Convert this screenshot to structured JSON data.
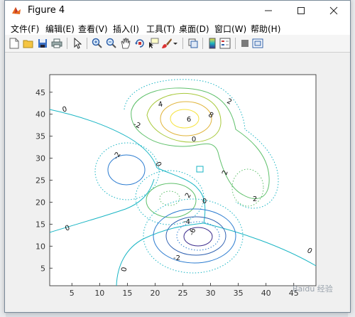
{
  "window": {
    "title": "Figure 4"
  },
  "menu": [
    {
      "label": "文件(F)"
    },
    {
      "label": "编辑(E)"
    },
    {
      "label": "查看(V)"
    },
    {
      "label": "插入(I)"
    },
    {
      "label": "工具(T)"
    },
    {
      "label": "桌面(D)"
    },
    {
      "label": "窗口(W)"
    },
    {
      "label": "帮助(H)"
    }
  ],
  "toolbar": [
    "new-figure-icon",
    "open-file-icon",
    "save-icon",
    "print-icon",
    "pointer-icon",
    "zoom-in-icon",
    "zoom-out-icon",
    "pan-hand-icon",
    "rotate-3d-icon",
    "data-cursor-icon",
    "brush-icon",
    "brush-dropdown-icon",
    "link-plot-icon",
    "colorbar-icon",
    "legend-icon",
    "hide-plot-tools-icon",
    "show-plot-tools-icon"
  ],
  "chart_data": {
    "type": "contour",
    "title": "",
    "xlabel": "",
    "ylabel": "",
    "xlim": [
      1,
      49
    ],
    "ylim": [
      1,
      49
    ],
    "x_ticks": [
      5,
      10,
      15,
      20,
      25,
      30,
      35,
      40,
      45
    ],
    "y_ticks": [
      5,
      10,
      15,
      20,
      25,
      30,
      35,
      40,
      45
    ],
    "contour_labels": [
      "0",
      "2",
      "4",
      "6",
      "8",
      "-2",
      "0",
      "0",
      "-2",
      "2",
      "2",
      "2",
      "0",
      "-4",
      "-6",
      "-2",
      "0",
      "0",
      "0"
    ],
    "colors": {
      "negative_deep": "#3a2a8c",
      "negative": "#2a7bd0",
      "zero": "#19b5c4",
      "positive": "#5fc06b",
      "positive_high": "#f2c14e",
      "highest": "#f5e23c"
    },
    "grid": false
  },
  "watermark": "Baidu 经验"
}
